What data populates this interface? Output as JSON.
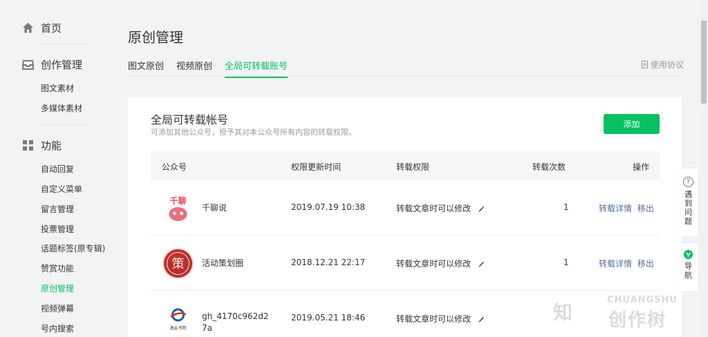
{
  "sidebar": {
    "home": "首页",
    "creation": {
      "title": "创作管理",
      "items": [
        "图文素材",
        "多媒体素材"
      ]
    },
    "features": {
      "title": "功能",
      "items": [
        "自动回复",
        "自定义菜单",
        "留言管理",
        "投票管理",
        "话题标签(原专辑)",
        "赞赏功能",
        "原创管理",
        "视频弹幕",
        "号内搜索"
      ],
      "active_index": 6
    }
  },
  "header": {
    "title": "原创管理",
    "tabs": [
      "图文原创",
      "视频原创",
      "全局可转载账号"
    ],
    "active_tab": 2,
    "agreement": "使用协议"
  },
  "card": {
    "title": "全局可转载帐号",
    "description": "可添加其他公众号，授予其对本公众号所有内容的转载权限。",
    "add_button": "添加",
    "columns": [
      "公众号",
      "权限更新时间",
      "转载权限",
      "转载次数",
      "操作"
    ],
    "rows": [
      {
        "name": "千聊说",
        "time": "2019.07.19 10:38",
        "permission": "转载文章时可以修改",
        "count": "1",
        "op_detail": "转载详情",
        "op_remove": "移出",
        "avatar_text": "千聊"
      },
      {
        "name": "活动策划圈",
        "time": "2018.12.21 22:17",
        "permission": "转载文章时可以修改",
        "count": "1",
        "op_detail": "转载详情",
        "op_remove": "移出",
        "avatar_text": "策"
      },
      {
        "name": "gh_4170c962d27a",
        "time": "2019.05.21 18:46",
        "permission": "转载文章时可以修改",
        "count": "",
        "op_detail": "",
        "op_remove": "",
        "avatar_text": "逸云书院"
      }
    ]
  },
  "float": {
    "help": [
      "遇",
      "到",
      "问",
      "题"
    ],
    "guide": [
      "导",
      "航"
    ]
  },
  "watermark": {
    "latin": "CHUANGSHU",
    "cn": "创作树",
    "left": "知"
  },
  "colors": {
    "accent": "#07c160",
    "link": "#576b95"
  }
}
